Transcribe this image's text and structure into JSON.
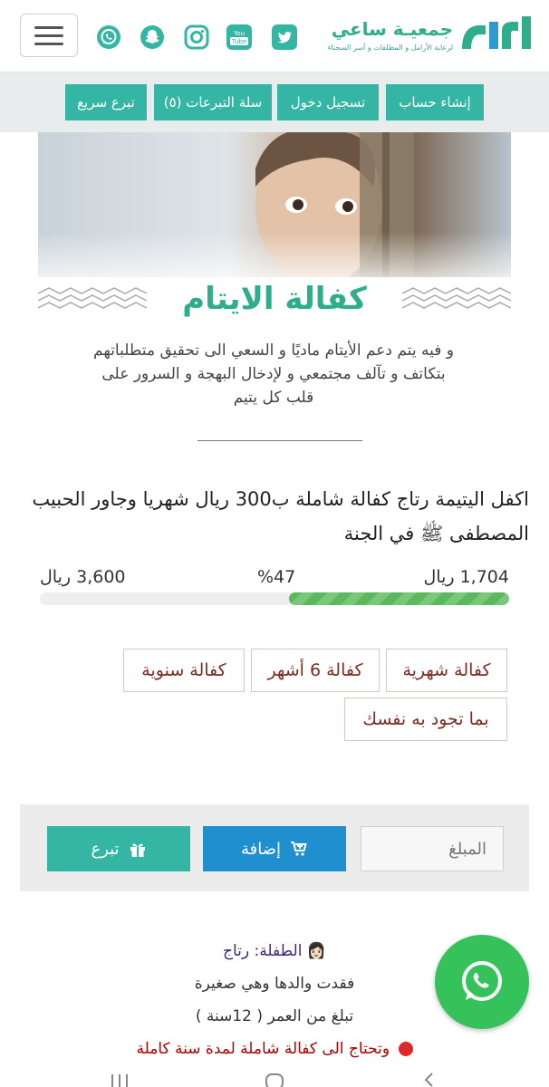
{
  "header": {
    "logo_title": "جمعيـة ساعي",
    "logo_subtitle": "لرعاية الأرامل و المطلقات و أسر السجناء",
    "social_icons": [
      "twitter-icon",
      "youtube-icon",
      "instagram-icon",
      "snapchat-icon",
      "whatsapp-icon"
    ],
    "youtube_label": "You Tube",
    "brand_color": "#2eae8a"
  },
  "nav": {
    "items": [
      {
        "label": "إنشاء حساب"
      },
      {
        "label": "تسجيل دخول"
      },
      {
        "label": "سلة التبرعات (٥)"
      },
      {
        "label": "تبرع سريع"
      }
    ],
    "button_color": "#35b5a4"
  },
  "banner": {
    "title": "كفالة الايتام",
    "text": "و فيه يتم دعم الأيتام ماديًا و السعي الى تحقيق متطلباتهم بتكاتف و تآلف مجتمعي و لإدخال البهجة و السرور على قلب كل يتيم"
  },
  "campaign": {
    "title": "اكفل اليتيمة رتاج كفالة شاملة ب300 ريال شهريا وجاور الحبيب المصطفى ﷺ في الجنة",
    "raised": "1,704 ريال",
    "percent_label": "%47",
    "goal": "3,600 ريال",
    "progress_fraction": 0.47,
    "options": [
      {
        "label": "كفالة شهرية"
      },
      {
        "label": "كفالة 6 أشهر"
      },
      {
        "label": "كفالة سنوية"
      },
      {
        "label": "بما تجود به نفسك"
      }
    ]
  },
  "donate": {
    "amount_placeholder": "المبلغ",
    "add_label": "إضافة",
    "give_label": "تبرع",
    "add_color": "#1f8fd0"
  },
  "details": {
    "child_emoji": "👩🏻",
    "child_line": "الطفلة: رتاج",
    "line2": "فقدت والدها وهي صغيرة",
    "line3": "تبلغ من العمر ( 12سنة )",
    "line4": "وتحتاج الى كفالة شاملة لمدة سنة كاملة"
  }
}
